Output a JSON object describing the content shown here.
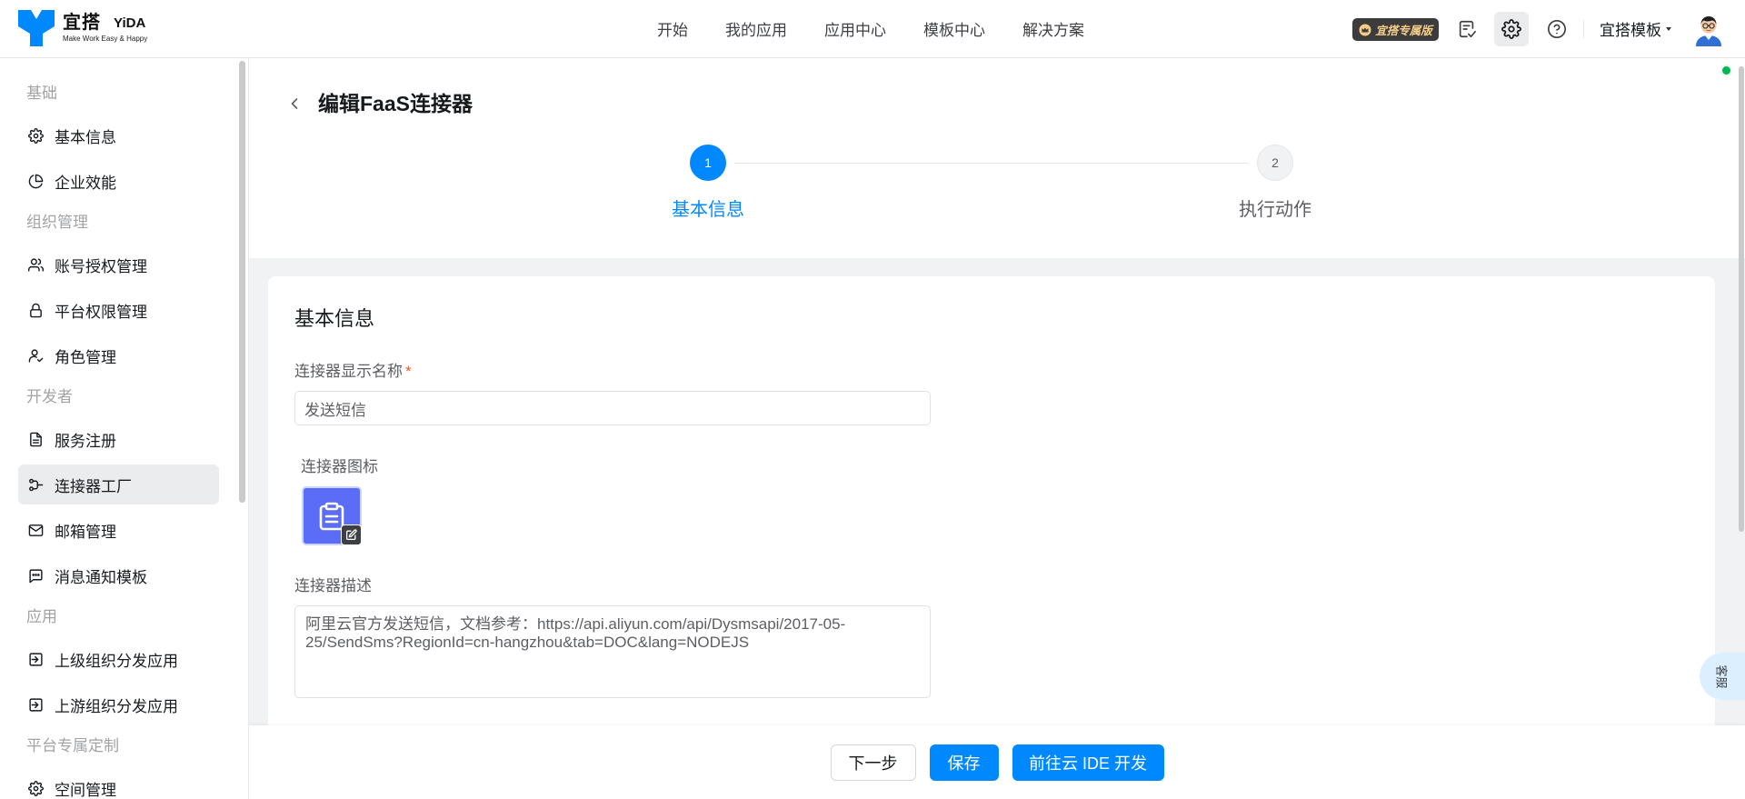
{
  "header": {
    "logo": {
      "cn": "宜搭",
      "en": "YiDA",
      "tagline": "Make Work Easy & Happy"
    },
    "nav": [
      {
        "label": "开始"
      },
      {
        "label": "我的应用"
      },
      {
        "label": "应用中心"
      },
      {
        "label": "模板中心"
      },
      {
        "label": "解决方案"
      }
    ],
    "badge": {
      "label": "宜搭专属版",
      "icon": "crown-icon"
    },
    "tools": [
      {
        "icon": "task-list-icon"
      },
      {
        "icon": "settings-icon",
        "active": true
      },
      {
        "icon": "help-icon"
      }
    ],
    "org_menu": {
      "label": "宜搭模板",
      "icon": "caret-down-icon"
    },
    "avatar": {
      "icon": "user-avatar"
    }
  },
  "sidebar": {
    "sections": [
      {
        "title": "基础",
        "items": [
          {
            "label": "基本信息",
            "icon": "gear-icon"
          },
          {
            "label": "企业效能",
            "icon": "pie-chart-icon"
          }
        ]
      },
      {
        "title": "组织管理",
        "items": [
          {
            "label": "账号授权管理",
            "icon": "users-icon"
          },
          {
            "label": "平台权限管理",
            "icon": "lock-icon"
          },
          {
            "label": "角色管理",
            "icon": "user-check-icon"
          }
        ]
      },
      {
        "title": "开发者",
        "items": [
          {
            "label": "服务注册",
            "icon": "document-icon"
          },
          {
            "label": "连接器工厂",
            "icon": "connector-icon",
            "active": true
          },
          {
            "label": "邮箱管理",
            "icon": "mail-icon"
          },
          {
            "label": "消息通知模板",
            "icon": "message-icon"
          }
        ]
      },
      {
        "title": "应用",
        "items": [
          {
            "label": "上级组织分发应用",
            "icon": "sign-in-icon"
          },
          {
            "label": "上游组织分发应用",
            "icon": "sign-in-icon"
          }
        ]
      },
      {
        "title": "平台专属定制",
        "items": [
          {
            "label": "空间管理",
            "icon": "gear-icon"
          }
        ]
      }
    ]
  },
  "page": {
    "title": "编辑FaaS连接器",
    "back_icon": "chevron-left-icon",
    "steps": [
      {
        "number": "1",
        "label": "基本信息",
        "state": "active"
      },
      {
        "number": "2",
        "label": "执行动作",
        "state": "pending"
      }
    ]
  },
  "form": {
    "heading": "基本信息",
    "name_label": "连接器显示名称",
    "required_mark": "*",
    "name_value": "发送短信",
    "icon_label": "连接器图标",
    "icon": "clipboard-icon",
    "desc_label": "连接器描述",
    "desc_value": "阿里云官方发送短信，文档参考：https://api.aliyun.com/api/Dysmsapi/2017-05-25/SendSms?RegionId=cn-hangzhou&tab=DOC&lang=NODEJS"
  },
  "footer": {
    "next_label": "下一步",
    "save_label": "保存",
    "ide_label": "前往云 IDE 开发"
  },
  "floating": {
    "label": "客服",
    "status": "online"
  },
  "colors": {
    "primary": "#0089ff",
    "active_bg": "#ebecee",
    "page_bg": "#f1f2f3",
    "badge_bg": "#3c3c3c",
    "badge_text": "#f5cd88",
    "required": "#ff5219",
    "online": "#00b853",
    "icon_tile": "#5b6cf6"
  }
}
